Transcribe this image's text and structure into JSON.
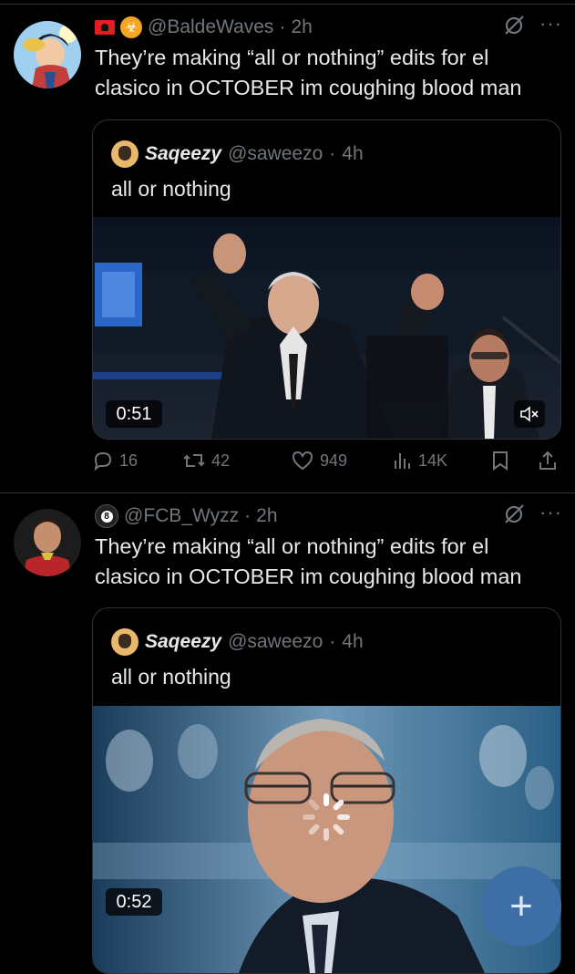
{
  "tweets": [
    {
      "handle": "@BaldeWaves",
      "time": "2h",
      "text": "They’re making “all or nothing” edits for el clasico in OCTOBER im coughing blood man",
      "quote": {
        "name": "Saqeezy",
        "handle": "@saweezo",
        "time": "4h",
        "text": "all or nothing",
        "video_duration": "0:51"
      },
      "actions": {
        "replies": "16",
        "reposts": "42",
        "likes": "949",
        "views": "14K"
      }
    },
    {
      "handle": "@FCB_Wyzz",
      "time": "2h",
      "text": "They’re making “all or nothing” edits for el clasico in OCTOBER im coughing blood man",
      "quote": {
        "name": "Saqeezy",
        "handle": "@saweezo",
        "time": "4h",
        "text": "all or nothing",
        "video_duration": "0:52"
      }
    }
  ],
  "icons": {
    "more": "more-dots-icon",
    "grok": "grok-slash-icon",
    "reply": "reply-icon",
    "repost": "repost-icon",
    "like": "heart-icon",
    "views": "views-bar-icon",
    "bookmark": "bookmark-icon",
    "share": "share-icon",
    "fab": "compose-plus-icon"
  },
  "fab_label": "+",
  "colors": {
    "background": "#000000",
    "text": "#e7e9ea",
    "muted": "#71767b",
    "border": "#2f3336",
    "fab": "#3d6ea5"
  }
}
